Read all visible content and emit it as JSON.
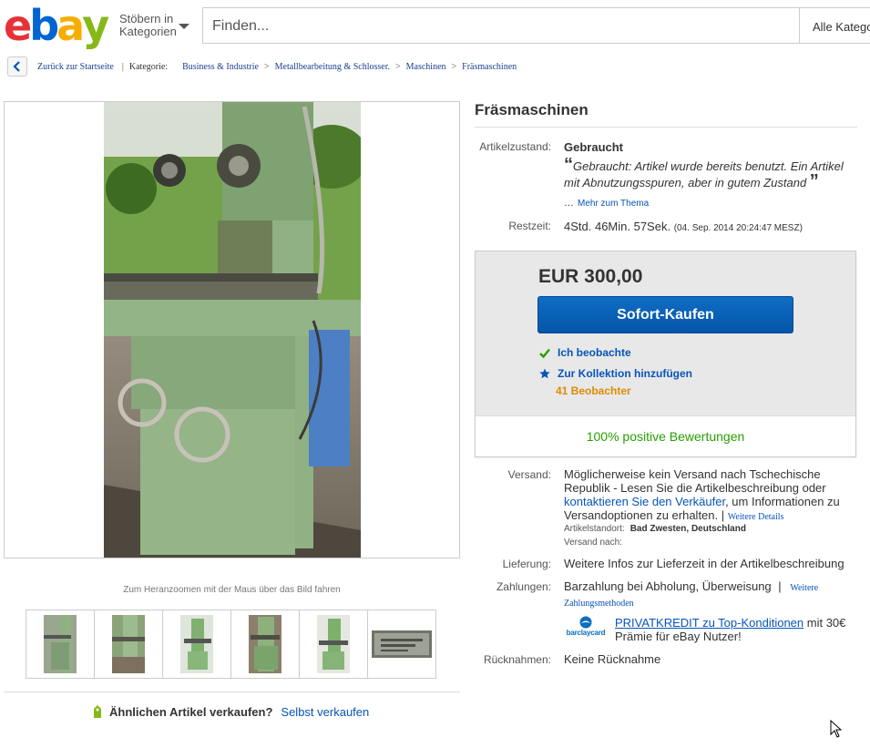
{
  "header": {
    "logo_letters": [
      "e",
      "b",
      "a",
      "y"
    ],
    "logo_colors": [
      "#e53238",
      "#0064d2",
      "#f5af02",
      "#86b817"
    ],
    "browse_line1": "Stöbern in",
    "browse_line2": "Kategorien",
    "search_placeholder": "Finden...",
    "category_select": "Alle Katego"
  },
  "breadcrumb": {
    "back": "Zurück zur Startseite",
    "category_label": "Kategorie:",
    "items": [
      "Business & Industrie",
      "Metallbearbeitung & Schlosser.",
      "Maschinen",
      "Fräsmaschinen"
    ]
  },
  "gallery": {
    "zoom_hint": "Zum Heranzoomen mit der Maus über das Bild fahren",
    "thumbnail_count": 6
  },
  "sell": {
    "question": "Ähnlichen Artikel verkaufen?",
    "link": "Selbst verkaufen"
  },
  "item": {
    "title": "Fräsmaschinen",
    "condition_label": "Artikelzustand:",
    "condition": "Gebraucht",
    "condition_desc": "Gebraucht: Artikel wurde bereits benutzt. Ein Artikel mit Abnutzungsspuren, aber in gutem Zustand",
    "condition_more_prefix": "…",
    "condition_more": "Mehr zum Thema",
    "time_label": "Restzeit:",
    "time_left": "4Std. 46Min. 57Sek.",
    "time_end": "(04. Sep. 2014  20:24:47 MESZ)"
  },
  "buybox": {
    "price": "EUR 300,00",
    "buy_now": "Sofort-Kaufen",
    "watching": "Ich beobachte",
    "add_collection": "Zur Kollektion hinzufügen",
    "watchers": "41 Beobachter",
    "feedback": "100% positive Bewertungen"
  },
  "details": {
    "shipping_label": "Versand:",
    "shipping_text1": "Möglicherweise kein Versand nach Tschechische Republik - Lesen Sie die Artikelbeschreibung oder",
    "shipping_link": "kontaktieren Sie den Verkäufer",
    "shipping_text2": ", um Informationen zu Versandoptionen zu erhalten.",
    "shipping_sep": "|",
    "shipping_more": "Weitere Details",
    "location_label": "Artikelstandort:",
    "location": "Bad Zwesten, Deutschland",
    "ships_to_label": "Versand nach:",
    "delivery_label": "Lieferung:",
    "delivery": "Weitere Infos zur Lieferzeit in der Artikelbeschreibung",
    "payment_label": "Zahlungen:",
    "payment": "Barzahlung bei Abholung,  Überweisung",
    "payment_sep": "|",
    "payment_more": "Weitere Zahlungsmethoden",
    "credit_brand": "barclaycard",
    "credit_link": "PRIVATKREDIT zu Top-Konditionen",
    "credit_text": " mit 30€ Prämie für eBay Nutzer!",
    "returns_label": "Rücknahmen:",
    "returns": "Keine Rücknahme"
  }
}
